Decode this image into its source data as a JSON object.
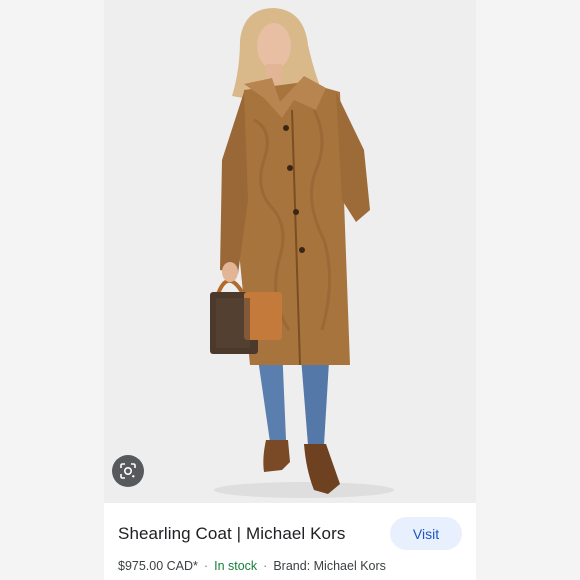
{
  "product": {
    "title": "Shearling Coat | Michael Kors",
    "visit_label": "Visit",
    "price": "$975.00 CAD*",
    "separator": "·",
    "stock_status": "In stock",
    "brand": "Brand: Michael Kors"
  },
  "icons": {
    "lens": "google-lens-icon"
  },
  "colors": {
    "stock_green": "#188038",
    "visit_bg": "#e8f0fe",
    "visit_text": "#1a56c4",
    "coat": "#a8743e"
  }
}
